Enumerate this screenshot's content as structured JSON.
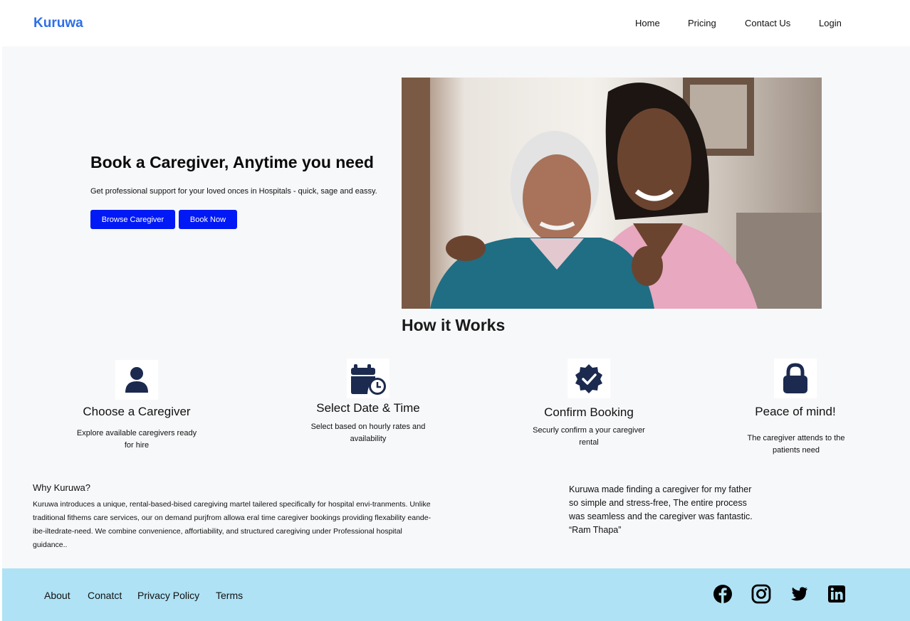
{
  "header": {
    "logo": "Kuruwa",
    "nav": [
      "Home",
      "Pricing",
      "Contact Us",
      "Login"
    ]
  },
  "hero": {
    "title": "Book a Caregiver, Anytime you need",
    "subtitle": "Get professional support for your loved onces in Hospitals - quick, sage and eassy.",
    "browse_button": "Browse Caregiver",
    "book_button": "Book Now"
  },
  "how_it_works": {
    "title": "How it Works",
    "steps": [
      {
        "icon": "user-icon",
        "title": "Choose a Caregiver",
        "desc": "Explore available caregivers ready for hire"
      },
      {
        "icon": "calendar-clock-icon",
        "title": "Select Date & Time",
        "desc": "Select based on hourly rates and availability"
      },
      {
        "icon": "verified-check-icon",
        "title": "Confirm Booking",
        "desc": "Securly confirm a your caregiver rental"
      },
      {
        "icon": "lock-icon",
        "title": "Peace of mind!",
        "desc": "The caregiver attends to the patients need"
      }
    ]
  },
  "why": {
    "title": "Why Kuruwa?",
    "body": "Kuruwa introduces a unique, rental-based-bised caregiving martel tailered specifically for hospital envi-tranments. Unlike traditional fithems care services, our on demand purjfrom allowa eral time caregiver bookings providing flexability eande-ibe-iltedrate-need. We combine convenience, affortiability, and structured caregiving under Professional hospital guidance.."
  },
  "testimonial": {
    "quote": "Kuruwa made finding a caregiver for my father so simple and stress-free, The entire process was seamless and the caregiver was fantastic.",
    "author": "“Ram Thapa”"
  },
  "footer": {
    "links": [
      "About",
      "Conatct",
      "Privacy Policy",
      "Terms"
    ],
    "social": [
      "facebook-icon",
      "instagram-icon",
      "twitter-icon",
      "linkedin-icon"
    ]
  },
  "colors": {
    "brand": "#2d6fe8",
    "button": "#0019f5",
    "icon": "#1b2a4e",
    "footer_bg": "#afe2f5"
  }
}
